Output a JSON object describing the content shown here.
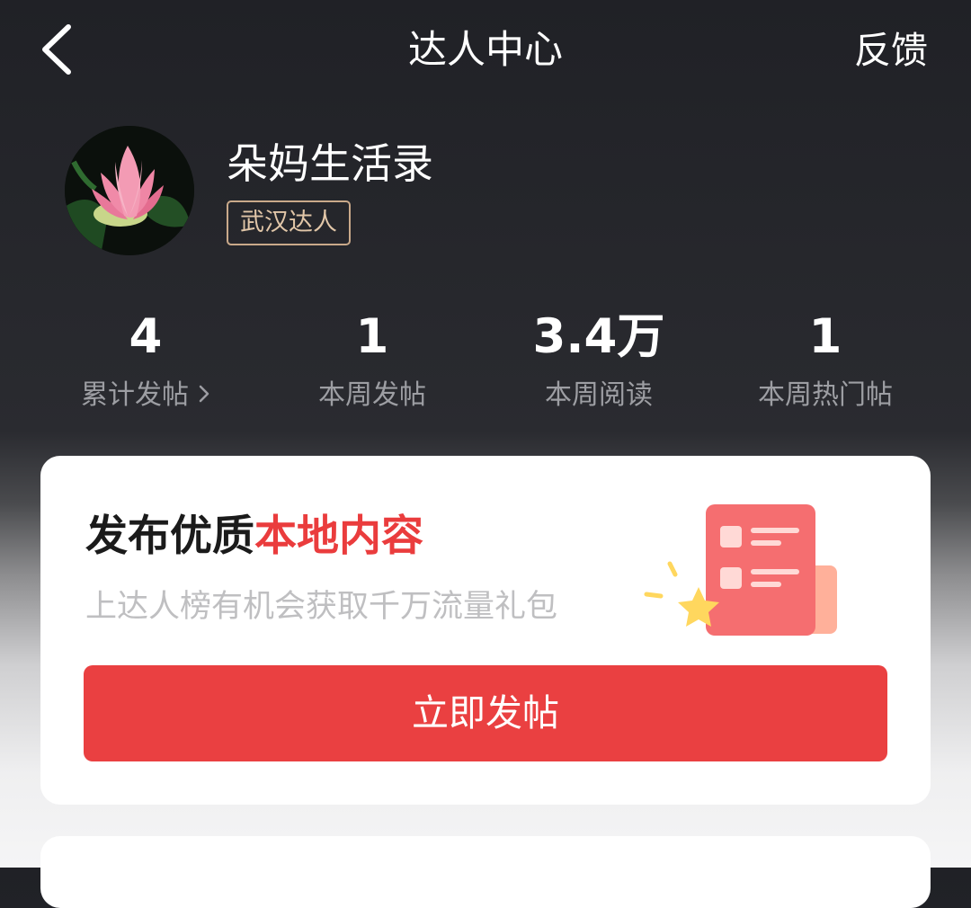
{
  "header": {
    "title": "达人中心",
    "feedback_label": "反馈"
  },
  "profile": {
    "name": "朵妈生活录",
    "badge": "武汉达人"
  },
  "stats": [
    {
      "value": "4",
      "label": "累计发帖"
    },
    {
      "value": "1",
      "label": "本周发帖"
    },
    {
      "value": "3.4万",
      "label": "本周阅读"
    },
    {
      "value": "1",
      "label": "本周热门帖"
    }
  ],
  "promo": {
    "title_prefix": "发布优质",
    "title_accent": "本地内容",
    "subtitle": "上达人榜有机会获取千万流量礼包",
    "button_label": "立即发帖"
  },
  "colors": {
    "accent_red": "#ea4041",
    "badge_gold": "#c9a98a",
    "header_bg": "#202126"
  },
  "icons": {
    "back": "chevron-left-icon",
    "stat_chevron": "chevron-right-icon",
    "avatar": "lotus-flower-image",
    "illustration": "document-star-illustration"
  }
}
